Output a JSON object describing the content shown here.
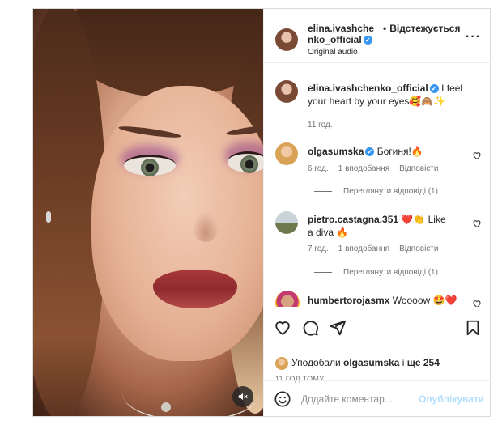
{
  "post": {
    "username": "elina.ivashchenko_official",
    "username_line1": "elina.ivashche",
    "username_line2": "nko_official",
    "follow_status": "Відстежується",
    "audio": "Original audio"
  },
  "caption": {
    "username": "elina.ivashchenko_official",
    "text": "I feel your heart by your eyes🥰🙈✨",
    "time": "11 год."
  },
  "comments": [
    {
      "username": "olgasumska",
      "verified": true,
      "text": "Богиня!🔥",
      "time": "6 год.",
      "likes": "1 вподобання",
      "reply": "Відповісти",
      "view_replies": "Переглянути відповіді (1)"
    },
    {
      "username": "pietro.castagna.351",
      "verified": false,
      "text": "❤️👏 Like a diva 🔥",
      "time": "7 год.",
      "likes": "1 вподобання",
      "reply": "Відповісти",
      "view_replies": "Переглянути відповіді (1)"
    },
    {
      "username": "humbertorojasmx",
      "verified": false,
      "text": "Woooow 🤩❤️"
    }
  ],
  "likes_summary": {
    "prefix": "Уподобали",
    "user": "olgasumska",
    "connector": "і",
    "others": "ще 254"
  },
  "time_ago": "11 ГОД ТОМУ",
  "add_comment": {
    "placeholder": "Додайте коментар...",
    "publish": "Опублікувати"
  },
  "colors": {
    "verified": "#3897f0",
    "publish_disabled": "#b2dffc",
    "secondary_text": "#737373"
  },
  "icons": {
    "more": "more-horizontal-icon",
    "like": "heart-outline-icon",
    "comment": "comment-bubble-icon",
    "share": "paper-plane-icon",
    "save": "bookmark-icon",
    "emoji": "smiley-icon",
    "mute": "speaker-muted-icon"
  }
}
